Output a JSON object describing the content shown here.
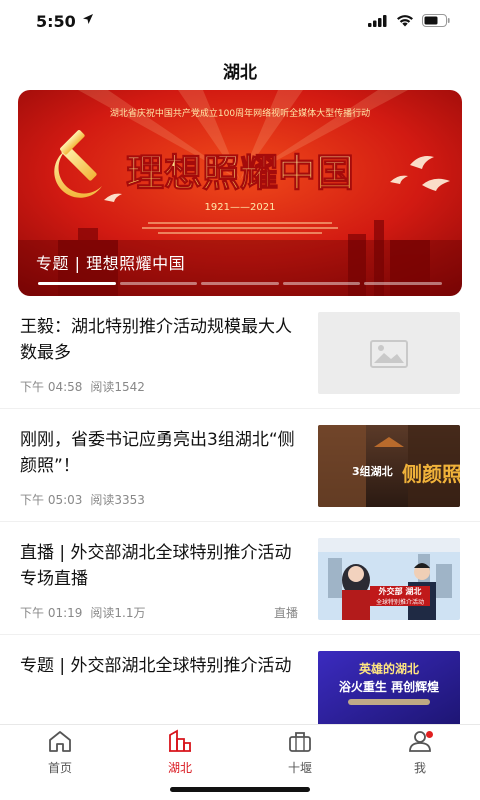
{
  "status_bar": {
    "time": "5:50"
  },
  "header": {
    "title": "湖北"
  },
  "banner": {
    "top_line": "湖北省庆祝中国共产党成立100周年网络视听全媒体大型传播行动",
    "headline": "理想照耀中国",
    "years": "1921——2021",
    "caption": "专题 | 理想照耀中国",
    "slide_count": 5,
    "active_slide": 0
  },
  "news": [
    {
      "title": "王毅：湖北特别推介活动规模最大人数最多",
      "time": "下午 04:58",
      "reads": "阅读1542",
      "tag": "",
      "thumb": "placeholder-image-icon"
    },
    {
      "title": "刚刚，省委书记应勇亮出3组湖北“侧颜照”！",
      "time": "下午 05:03",
      "reads": "阅读3353",
      "tag": "",
      "thumb": "cp-thumb",
      "thumb_text": "3组湖北",
      "thumb_big": "侧颜照"
    },
    {
      "title": "直播 | 外交部湖北全球特别推介活动专场直播",
      "time": "下午 01:19",
      "reads": "阅读1.1万",
      "tag": "直播",
      "thumb": "live-thumb",
      "thumb_text": "外交部 湖北",
      "thumb_sub": "全球特别推介活动"
    },
    {
      "title": "专题 | 外交部湖北全球特别推介活动",
      "time": "",
      "reads": "",
      "tag": "",
      "thumb": "topic-thumb",
      "thumb_text": "英雄的湖北",
      "thumb_sub": "浴火重生 再创辉煌"
    }
  ],
  "tabs": [
    {
      "label": "首页",
      "icon": "home-icon",
      "active": false
    },
    {
      "label": "湖北",
      "icon": "city-icon",
      "active": true
    },
    {
      "label": "十堰",
      "icon": "bag-icon",
      "active": false
    },
    {
      "label": "我",
      "icon": "user-icon",
      "active": false
    }
  ],
  "colors": {
    "accent": "#d8141c",
    "banner_red": "#c81010",
    "gold": "#ffd86b"
  }
}
